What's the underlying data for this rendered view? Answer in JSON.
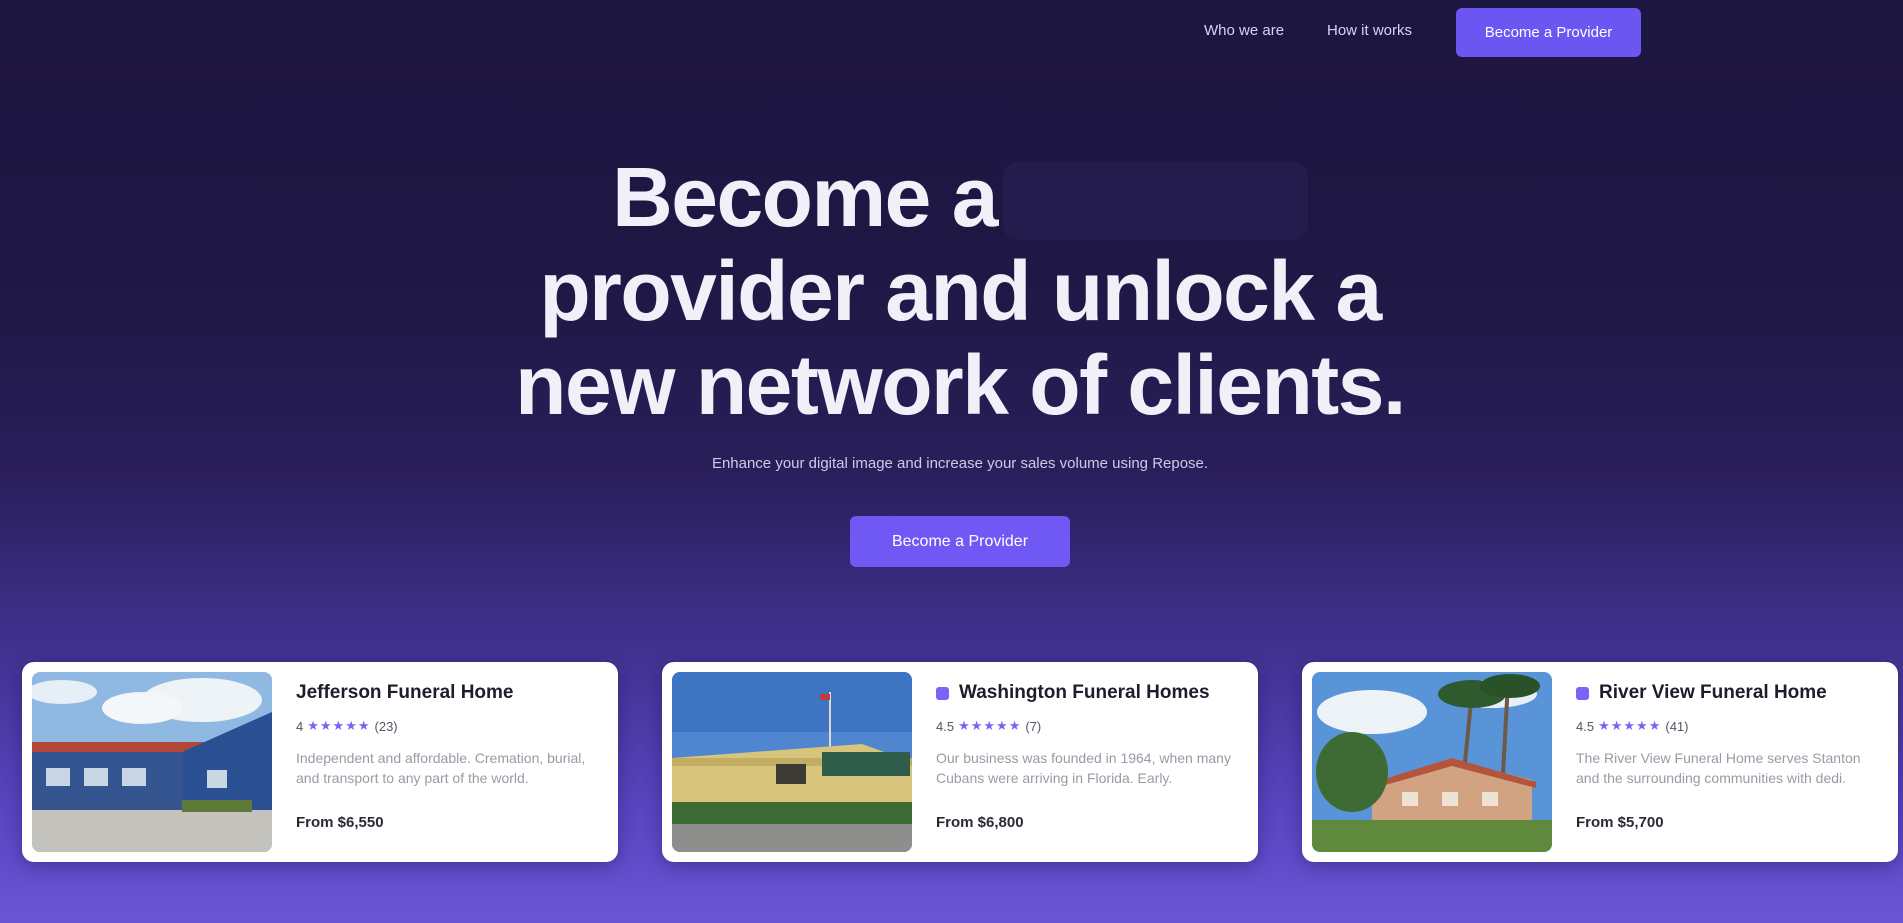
{
  "nav": {
    "links": [
      "Who we are",
      "How it works"
    ],
    "cta_label": "Become a Provider"
  },
  "hero": {
    "title_line1": "Become a",
    "title_rest": "provider and unlock a new network of clients.",
    "subtitle": "Enhance your digital image and increase your sales volume using Repose.",
    "cta_label": "Become a Provider"
  },
  "cards": [
    {
      "name": "Jefferson Funeral Home",
      "rating": "4",
      "stars": "★★★★★",
      "reviews": "(23)",
      "description": "Independent and affordable. Cremation, burial, and transport to any part of the world.",
      "price": "From $6,550"
    },
    {
      "name": "Washington Funeral Homes",
      "rating": "4.5",
      "stars": "★★★★★",
      "reviews": "(7)",
      "description": "Our business was founded in 1964, when many Cubans were arriving in Florida. Early.",
      "price": "From $6,800"
    },
    {
      "name": "River View Funeral Home",
      "rating": "4.5",
      "stars": "★★★★★",
      "reviews": "(41)",
      "description": "The River View Funeral Home serves Stanton and the surrounding communities with dedi.",
      "price": "From $5,700"
    }
  ],
  "colors": {
    "accent": "#6c56f2",
    "background_top": "#1d1640",
    "background_bottom": "#6a55d6"
  }
}
